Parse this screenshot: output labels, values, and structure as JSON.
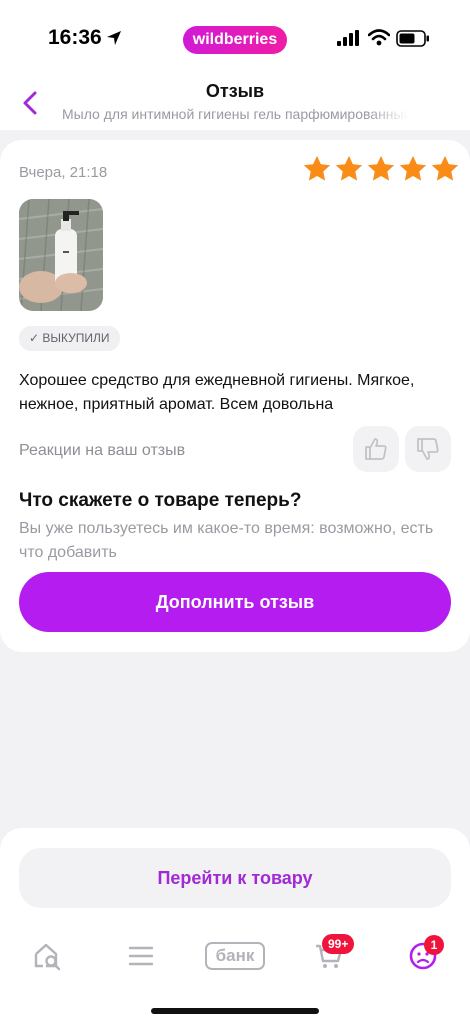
{
  "status_bar": {
    "time": "16:36",
    "app_pill": "wildberries"
  },
  "header": {
    "title": "Отзыв",
    "subtitle": "Мыло для интимной гигиены гель парфюмированный"
  },
  "review": {
    "date": "Вчера, 21:18",
    "rating": 5,
    "badge": "✓ ВЫКУПИЛИ",
    "text": "Хорошее средство для ежедневной гигиены. Мягкое, нежное, приятный аромат. Всем довольна",
    "reactions_label": "Реакции на ваш отзыв"
  },
  "prompt": {
    "title": "Что скажете о товаре теперь?",
    "subtitle": "Вы уже пользуетесь им какое-то время: возможно, есть что добавить",
    "button": "Дополнить отзыв"
  },
  "goto_product": "Перейти к товару",
  "tabbar": {
    "bank_label": "банк",
    "cart_badge": "99+",
    "profile_badge": "1"
  },
  "colors": {
    "accent": "#b51cf0",
    "star": "#f98b17",
    "badge_red": "#f0143c"
  }
}
